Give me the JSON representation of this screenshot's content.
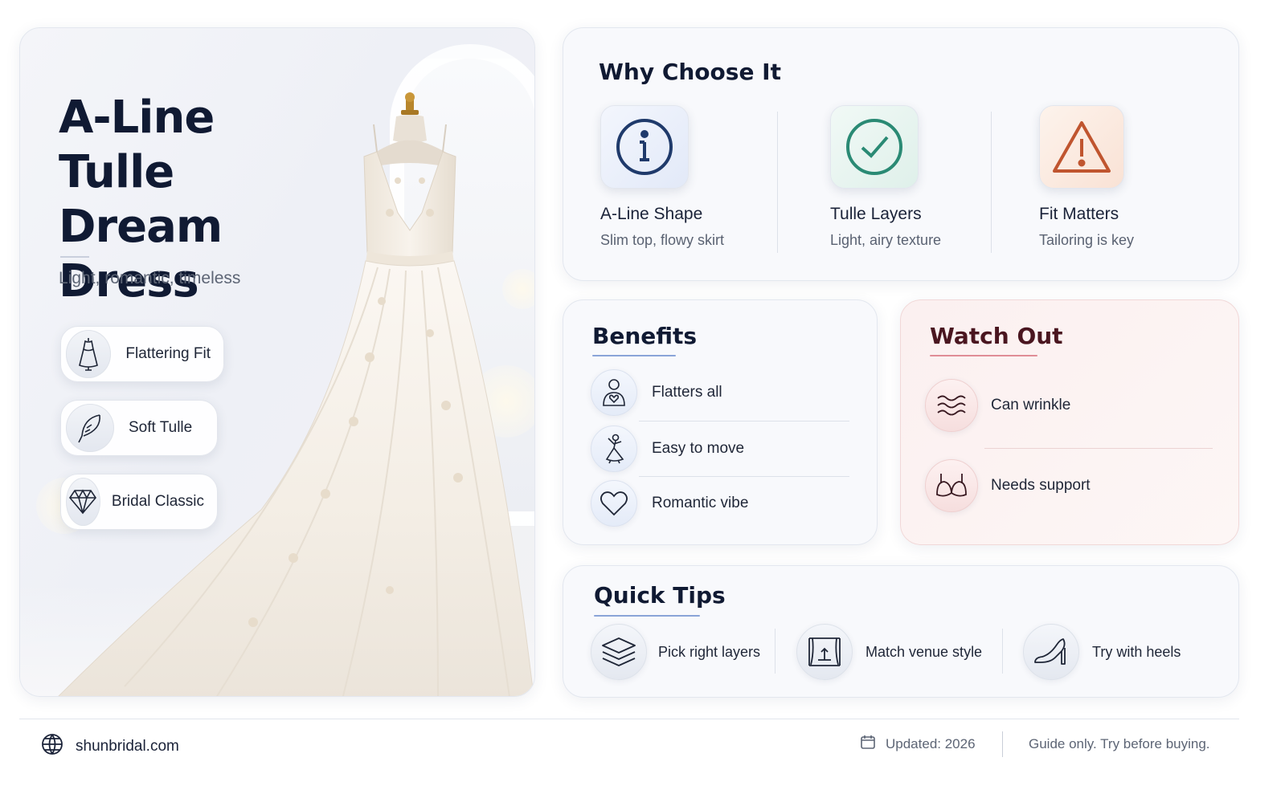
{
  "hero": {
    "title_line1": "A-Line",
    "title_line2": "Tulle Dream",
    "title_line3": "Dress",
    "subtitle": "Light, romantic, timeless",
    "features": [
      {
        "icon": "dress-icon",
        "label": "Flattering Fit"
      },
      {
        "icon": "feather-icon",
        "label": "Soft Tulle"
      },
      {
        "icon": "diamond-icon",
        "label": "Bridal Classic"
      }
    ]
  },
  "why": {
    "title": "Why Choose It",
    "items": [
      {
        "icon": "info-icon",
        "title": "A-Line Shape",
        "desc": "Slim top, flowy skirt",
        "color": "#1f3a6b"
      },
      {
        "icon": "check-circle-icon",
        "title": "Tulle Layers",
        "desc": "Light, airy texture",
        "color": "#2a8a74"
      },
      {
        "icon": "warning-triangle-icon",
        "title": "Fit Matters",
        "desc": "Tailoring is key",
        "color": "#c0552f"
      }
    ]
  },
  "benefits": {
    "title": "Benefits",
    "items": [
      {
        "icon": "person-heart-icon",
        "label": "Flatters all"
      },
      {
        "icon": "dancer-icon",
        "label": "Easy to move"
      },
      {
        "icon": "heart-icon",
        "label": "Romantic vibe"
      }
    ]
  },
  "watch_out": {
    "title": "Watch Out",
    "items": [
      {
        "icon": "wrinkle-waves-icon",
        "label": "Can wrinkle"
      },
      {
        "icon": "bra-icon",
        "label": "Needs support"
      }
    ]
  },
  "tips": {
    "title": "Quick Tips",
    "items": [
      {
        "icon": "layers-icon",
        "label": "Pick right layers"
      },
      {
        "icon": "venue-curtain-icon",
        "label": "Match venue style"
      },
      {
        "icon": "heel-shoe-icon",
        "label": "Try with heels"
      }
    ]
  },
  "footer": {
    "site": "shunbridal.com",
    "updated": "Updated: 2026",
    "note": "Guide only. Try before buying."
  },
  "colors": {
    "navy": "#101a33",
    "accent_blue": "#8aa4d8",
    "accent_red": "#e08d96",
    "watch_title": "#4a1620"
  }
}
